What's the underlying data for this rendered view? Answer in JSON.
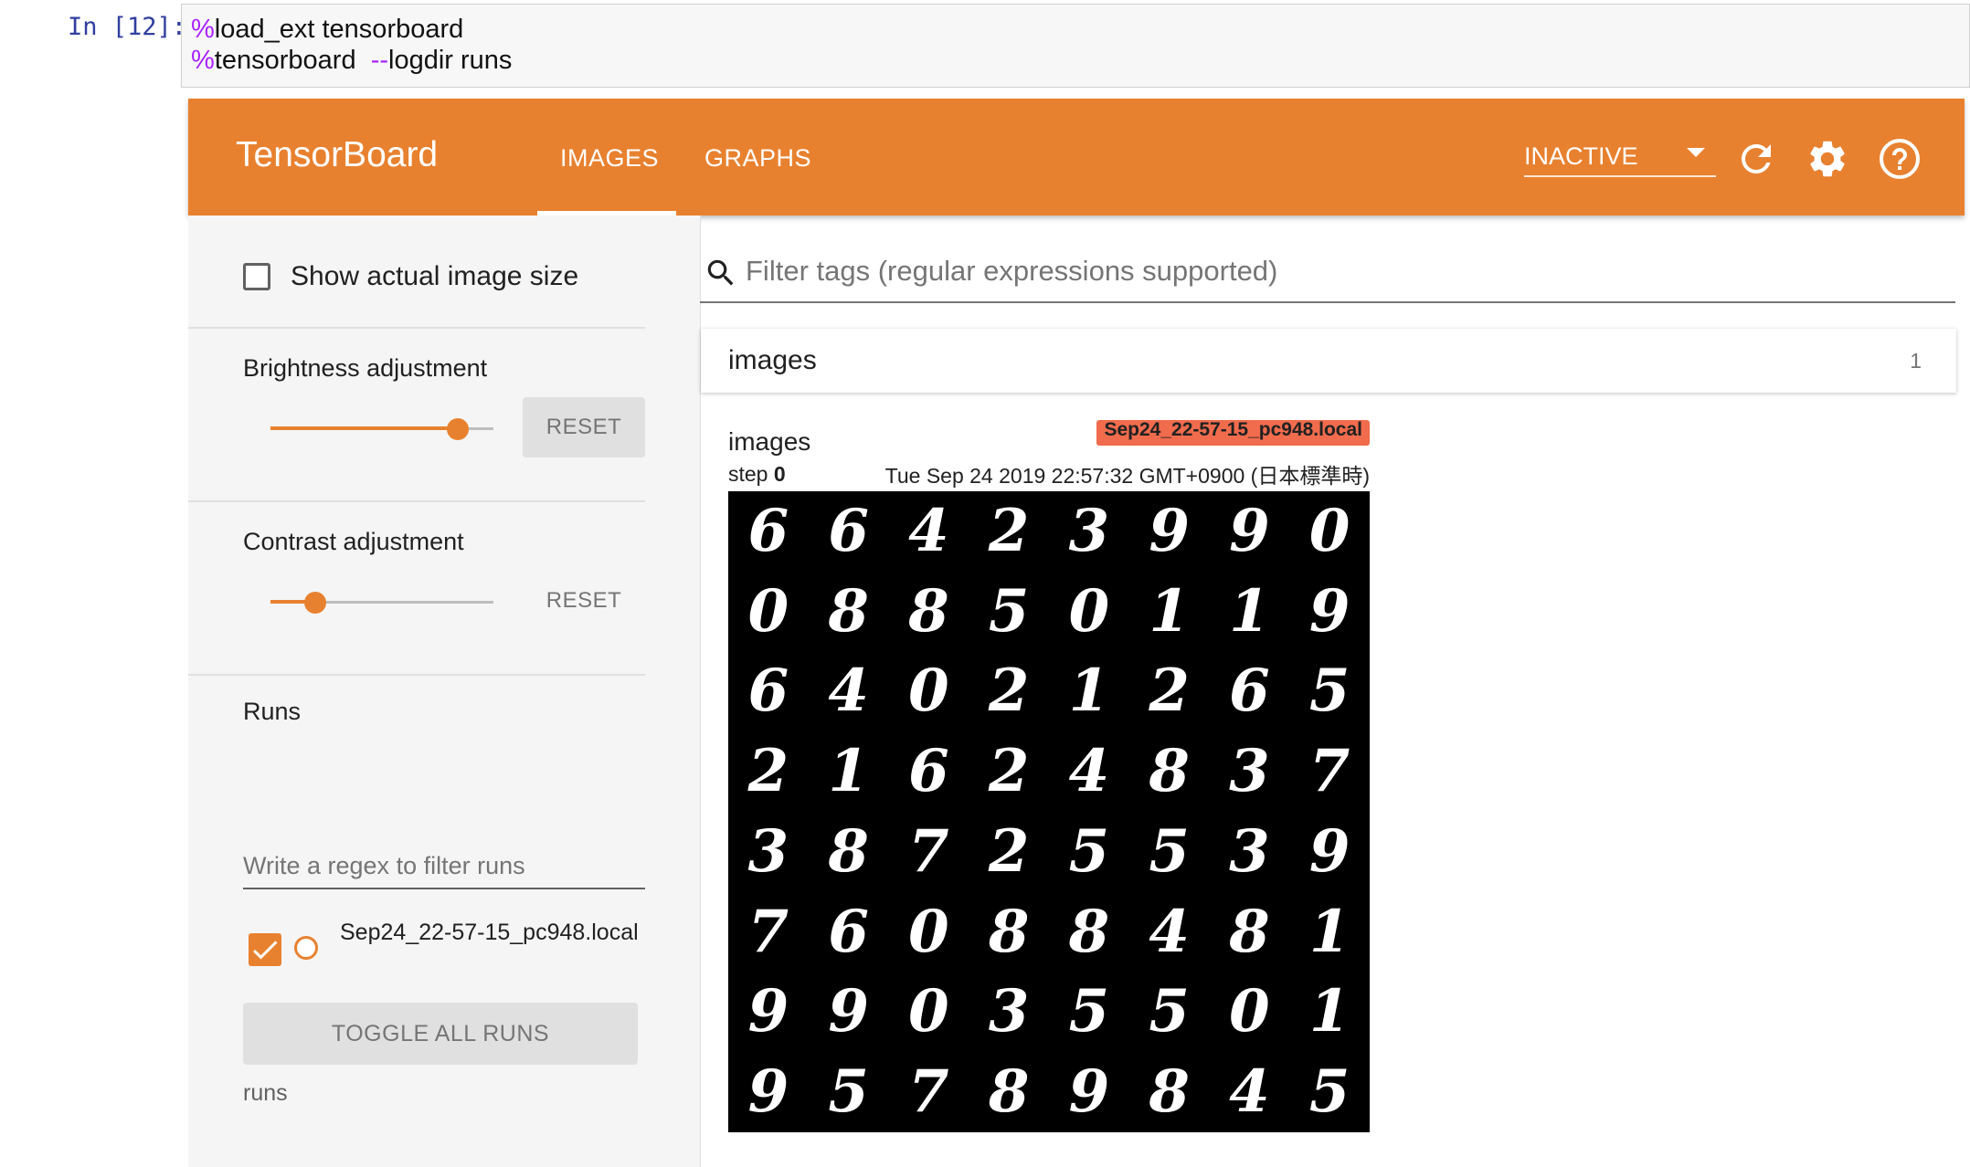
{
  "notebook": {
    "prompt": "In [12]:",
    "code_lines": [
      {
        "magic": "%",
        "text": "load_ext tensorboard"
      },
      {
        "magic": "%",
        "text": "tensorboard  ",
        "flag": "--",
        "rest": "logdir runs"
      }
    ]
  },
  "topbar": {
    "brand": "TensorBoard",
    "tabs": [
      "IMAGES",
      "GRAPHS"
    ],
    "active_tab": "IMAGES",
    "status": "INACTIVE",
    "color": "#e8812f",
    "icons": [
      "refresh-icon",
      "settings-icon",
      "help-icon"
    ]
  },
  "sidebar": {
    "show_actual_size_label": "Show actual image size",
    "show_actual_size_checked": false,
    "brightness": {
      "title": "Brightness adjustment",
      "value": 0.84,
      "reset": "RESET"
    },
    "contrast": {
      "title": "Contrast adjustment",
      "value": 0.2,
      "reset": "RESET"
    },
    "runs": {
      "title": "Runs",
      "filter_placeholder": "Write a regex to filter runs",
      "items": [
        {
          "name": "Sep24_22-57-15_pc948.local",
          "checked": true
        }
      ],
      "toggle_all": "TOGGLE ALL RUNS",
      "footer": "runs"
    }
  },
  "main": {
    "filter_placeholder": "Filter tags (regular expressions supported)",
    "pane": {
      "title": "images",
      "count": "1",
      "card": {
        "title": "images",
        "run_badge": "Sep24_22-57-15_pc948.local",
        "step_label": "step",
        "step_value": "0",
        "timestamp": "Tue Sep 24 2019 22:57:32 GMT+0900 (日本標準時)",
        "digits": [
          [
            "6",
            "6",
            "4",
            "2",
            "3",
            "9",
            "9",
            "0"
          ],
          [
            "0",
            "8",
            "8",
            "5",
            "0",
            "1",
            "1",
            "9"
          ],
          [
            "6",
            "4",
            "0",
            "2",
            "1",
            "2",
            "6",
            "5"
          ],
          [
            "2",
            "1",
            "6",
            "2",
            "4",
            "8",
            "3",
            "7"
          ],
          [
            "3",
            "8",
            "7",
            "2",
            "5",
            "5",
            "3",
            "9"
          ],
          [
            "7",
            "6",
            "0",
            "8",
            "8",
            "4",
            "8",
            "1"
          ],
          [
            "9",
            "9",
            "0",
            "3",
            "5",
            "5",
            "0",
            "1"
          ],
          [
            "9",
            "5",
            "7",
            "8",
            "9",
            "8",
            "4",
            "5"
          ]
        ]
      }
    }
  }
}
